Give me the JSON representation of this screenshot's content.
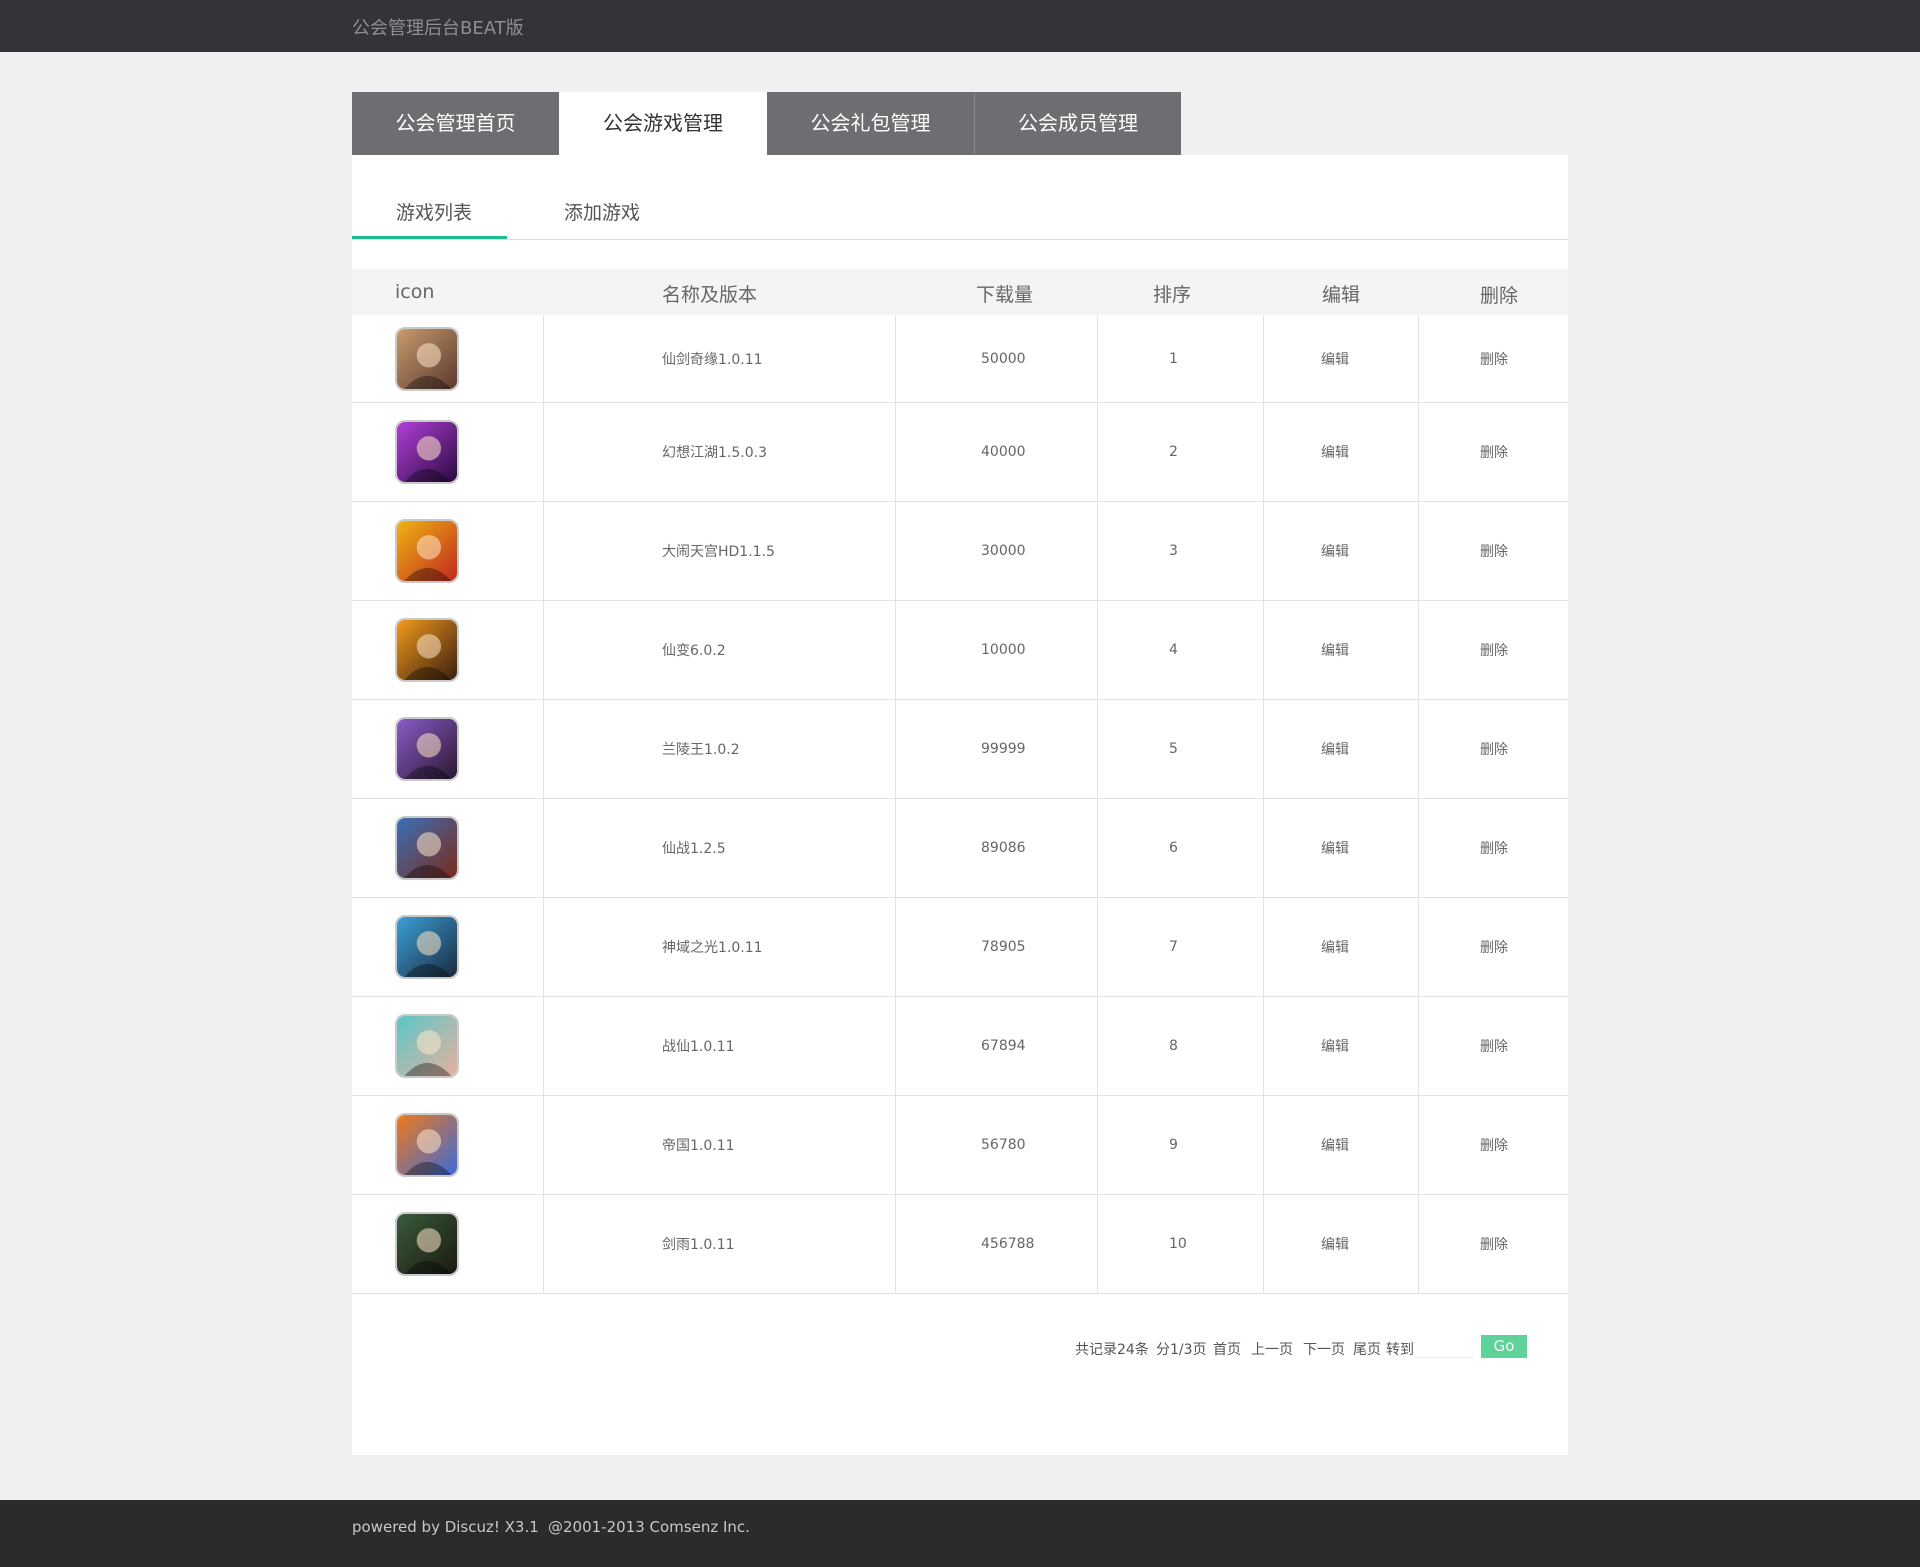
{
  "header": {
    "title": "公会管理后台BEAT版"
  },
  "main_tabs": [
    {
      "label": "公会管理首页",
      "active": false
    },
    {
      "label": "公会游戏管理",
      "active": true
    },
    {
      "label": "公会礼包管理",
      "active": false
    },
    {
      "label": "公会成员管理",
      "active": false
    }
  ],
  "sub_tabs": [
    {
      "label": "游戏列表",
      "active": true
    },
    {
      "label": "添加游戏",
      "active": false
    }
  ],
  "accent_color": "#22b892",
  "table": {
    "columns": [
      "icon",
      "名称及版本",
      "下载量",
      "排序",
      "编辑",
      "删除"
    ],
    "rows": [
      {
        "icon": "game-icon-xianjianqiyuan",
        "name": "仙剑奇缘1.0.11",
        "downloads": "50000",
        "order": "1",
        "edit": "编辑",
        "delete": "删除",
        "color1": "#c99a6e",
        "color2": "#5a3a2e"
      },
      {
        "icon": "game-icon-huanxiangjianghu",
        "name": "幻想江湖1.5.0.3",
        "downloads": "40000",
        "order": "2",
        "edit": "编辑",
        "delete": "删除",
        "color1": "#b23fd8",
        "color2": "#2a0a40"
      },
      {
        "icon": "game-icon-danaotiangong",
        "name": "大闹天宫HD1.1.5",
        "downloads": "30000",
        "order": "3",
        "edit": "编辑",
        "delete": "删除",
        "color1": "#f0b414",
        "color2": "#c0281e"
      },
      {
        "icon": "game-icon-xianbian",
        "name": "仙变6.0.2",
        "downloads": "10000",
        "order": "4",
        "edit": "编辑",
        "delete": "删除",
        "color1": "#f29a1c",
        "color2": "#3a1e10"
      },
      {
        "icon": "game-icon-lanlingwang",
        "name": "兰陵王1.0.2",
        "downloads": "99999",
        "order": "5",
        "edit": "编辑",
        "delete": "删除",
        "color1": "#8a5cc8",
        "color2": "#2a1830"
      },
      {
        "icon": "game-icon-xianzhan",
        "name": "仙战1.2.5",
        "downloads": "89086",
        "order": "6",
        "edit": "编辑",
        "delete": "删除",
        "color1": "#3a70b8",
        "color2": "#7a2a1a"
      },
      {
        "icon": "game-icon-shenyuzhiguang",
        "name": "神域之光1.0.11",
        "downloads": "78905",
        "order": "7",
        "edit": "编辑",
        "delete": "删除",
        "color1": "#3ca0d8",
        "color2": "#1a2a40"
      },
      {
        "icon": "game-icon-zhanxian",
        "name": "战仙1.0.11",
        "downloads": "67894",
        "order": "8",
        "edit": "编辑",
        "delete": "删除",
        "color1": "#5ac8c8",
        "color2": "#e8b0a0"
      },
      {
        "icon": "game-icon-diguo",
        "name": "帝国1.0.11",
        "downloads": "56780",
        "order": "9",
        "edit": "编辑",
        "delete": "删除",
        "color1": "#f07a1a",
        "color2": "#3a6ad8"
      },
      {
        "icon": "game-icon-jianyu",
        "name": "剑雨1.0.11",
        "downloads": "456788",
        "order": "10",
        "edit": "编辑",
        "delete": "删除",
        "color1": "#3a5a3a",
        "color2": "#1a1a10"
      }
    ]
  },
  "pager": {
    "total": "共记录24条",
    "pages": "分1/3页",
    "first": "首页",
    "prev": "上一页",
    "next": "下一页",
    "last": "尾页",
    "goto": "转到",
    "go": "Go"
  },
  "footer": {
    "powered": "powered by Discuz! X3.1",
    "copyright": "@2001-2013 Comsenz Inc."
  }
}
